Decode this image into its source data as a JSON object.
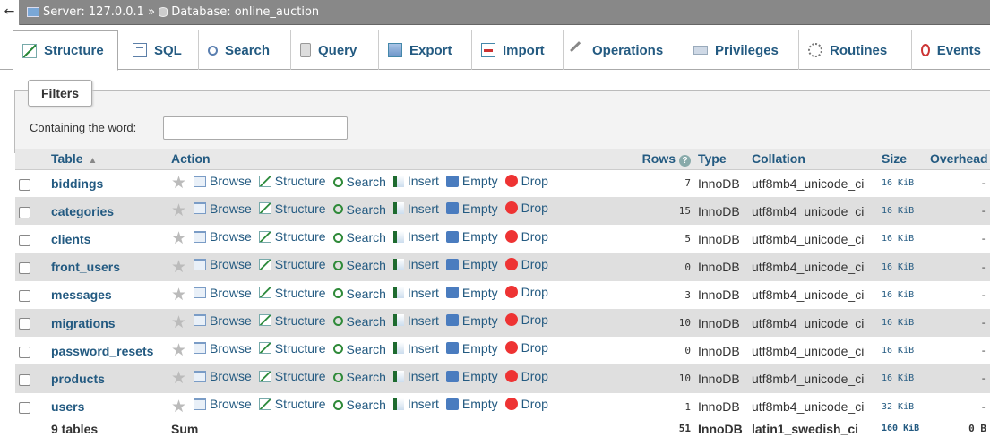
{
  "breadcrumb": {
    "back_glyph": "←",
    "server_label": "Server: 127.0.0.1",
    "separator": "»",
    "database_label": "Database: online_auction"
  },
  "tabs": [
    {
      "label": "Structure",
      "icon": "structure-icon",
      "active": true
    },
    {
      "label": "SQL",
      "icon": "sql-icon"
    },
    {
      "label": "Search",
      "icon": "search-icon"
    },
    {
      "label": "Query",
      "icon": "query-icon"
    },
    {
      "label": "Export",
      "icon": "export-icon"
    },
    {
      "label": "Import",
      "icon": "import-icon"
    },
    {
      "label": "Operations",
      "icon": "wrench-icon"
    },
    {
      "label": "Privileges",
      "icon": "privileges-icon"
    },
    {
      "label": "Routines",
      "icon": "routines-icon"
    },
    {
      "label": "Events",
      "icon": "events-icon"
    }
  ],
  "filters": {
    "legend": "Filters",
    "label": "Containing the word:",
    "value": ""
  },
  "table": {
    "headers": {
      "table": "Table",
      "action": "Action",
      "rows": "Rows",
      "type": "Type",
      "collation": "Collation",
      "size": "Size",
      "overhead": "Overhead"
    },
    "action_labels": {
      "browse": "Browse",
      "structure": "Structure",
      "search": "Search",
      "insert": "Insert",
      "empty": "Empty",
      "drop": "Drop"
    },
    "rows": [
      {
        "name": "biddings",
        "rows": "7",
        "type": "InnoDB",
        "collation": "utf8mb4_unicode_ci",
        "size": "16 KiB",
        "overhead": "-"
      },
      {
        "name": "categories",
        "rows": "15",
        "type": "InnoDB",
        "collation": "utf8mb4_unicode_ci",
        "size": "16 KiB",
        "overhead": "-"
      },
      {
        "name": "clients",
        "rows": "5",
        "type": "InnoDB",
        "collation": "utf8mb4_unicode_ci",
        "size": "16 KiB",
        "overhead": "-"
      },
      {
        "name": "front_users",
        "rows": "0",
        "type": "InnoDB",
        "collation": "utf8mb4_unicode_ci",
        "size": "16 KiB",
        "overhead": "-"
      },
      {
        "name": "messages",
        "rows": "3",
        "type": "InnoDB",
        "collation": "utf8mb4_unicode_ci",
        "size": "16 KiB",
        "overhead": "-"
      },
      {
        "name": "migrations",
        "rows": "10",
        "type": "InnoDB",
        "collation": "utf8mb4_unicode_ci",
        "size": "16 KiB",
        "overhead": "-"
      },
      {
        "name": "password_resets",
        "rows": "0",
        "type": "InnoDB",
        "collation": "utf8mb4_unicode_ci",
        "size": "16 KiB",
        "overhead": "-"
      },
      {
        "name": "products",
        "rows": "10",
        "type": "InnoDB",
        "collation": "utf8mb4_unicode_ci",
        "size": "16 KiB",
        "overhead": "-"
      },
      {
        "name": "users",
        "rows": "1",
        "type": "InnoDB",
        "collation": "utf8mb4_unicode_ci",
        "size": "32 KiB",
        "overhead": "-"
      }
    ],
    "footer": {
      "count": "9 tables",
      "sum_label": "Sum",
      "rows": "51",
      "type": "InnoDB",
      "collation": "latin1_swedish_ci",
      "size": "160 KiB",
      "overhead": "0 B"
    }
  }
}
